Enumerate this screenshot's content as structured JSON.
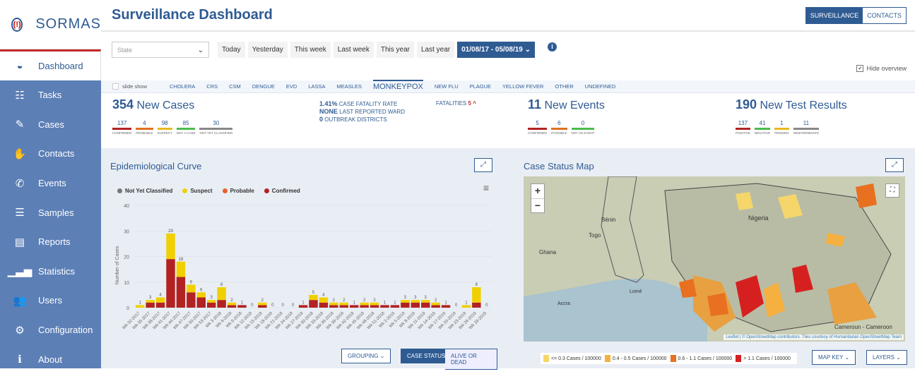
{
  "app": {
    "name": "SORMAS",
    "logo_mark": "(!)"
  },
  "sidebar": {
    "items": [
      {
        "label": "Dashboard",
        "icon": "dashboard-icon",
        "glyph": "◒"
      },
      {
        "label": "Tasks",
        "icon": "tasks-icon",
        "glyph": "☷"
      },
      {
        "label": "Cases",
        "icon": "edit-icon",
        "glyph": "✎"
      },
      {
        "label": "Contacts",
        "icon": "hand-icon",
        "glyph": "✋"
      },
      {
        "label": "Events",
        "icon": "phone-icon",
        "glyph": "✆"
      },
      {
        "label": "Samples",
        "icon": "database-icon",
        "glyph": "☰"
      },
      {
        "label": "Reports",
        "icon": "file-icon",
        "glyph": "▤"
      },
      {
        "label": "Statistics",
        "icon": "bar-chart-icon",
        "glyph": "▁▃▅"
      },
      {
        "label": "Users",
        "icon": "users-icon",
        "glyph": "👥"
      },
      {
        "label": "Configuration",
        "icon": "cogs-icon",
        "glyph": "⚙"
      },
      {
        "label": "About",
        "icon": "info-icon",
        "glyph": "ℹ"
      }
    ]
  },
  "header": {
    "title": "Surveillance Dashboard",
    "switch": [
      "SURVEILLANCE",
      "CONTACTS"
    ]
  },
  "filters": {
    "state_placeholder": "State",
    "periods": [
      "Today",
      "Yesterday",
      "This week",
      "Last week",
      "This year",
      "Last year"
    ],
    "date_range": "01/08/17 - 05/08/19 ⌄",
    "hide_overview": "Hide overview"
  },
  "diseases": {
    "slideshow": "slide show",
    "tabs": [
      "CHOLERA",
      "CRS",
      "CSM",
      "DENGUE",
      "EVD",
      "LASSA",
      "MEASLES",
      "MONKEYPOX",
      "NEW FLU",
      "PLAGUE",
      "YELLOW FEVER",
      "OTHER",
      "UNDEFINED"
    ],
    "active": "MONKEYPOX"
  },
  "cases": {
    "count": "354",
    "label": "New Cases",
    "parts": [
      {
        "v": "137",
        "l": "CONFIRMED",
        "c": "#b22222"
      },
      {
        "v": "4",
        "l": "PROBABLE",
        "c": "#e07020"
      },
      {
        "v": "98",
        "l": "SUSPECT",
        "c": "#e8b820"
      },
      {
        "v": "85",
        "l": "NOT A CASE",
        "c": "#4cbb4c"
      },
      {
        "v": "30",
        "l": "NOT YET CLASSIFIED",
        "c": "#888888"
      }
    ]
  },
  "mid": {
    "cfr": "1.41%",
    "cfr_l": "CASE FATALITY RATE",
    "ward": "NONE",
    "ward_l": "LAST REPORTED WARD",
    "outb": "0",
    "outb_l": "OUTBREAK DISTRICTS",
    "fat_l": "FATALITIES",
    "fat_v": "5"
  },
  "events": {
    "count": "11",
    "label": "New Events",
    "parts": [
      {
        "v": "5",
        "l": "CONFIRMED",
        "c": "#b22222"
      },
      {
        "v": "6",
        "l": "POSSIBLE",
        "c": "#e07020"
      },
      {
        "v": "0",
        "l": "NOT AN EVENT",
        "c": "#4cbb4c"
      }
    ]
  },
  "tests": {
    "count": "190",
    "label": "New Test Results",
    "parts": [
      {
        "v": "137",
        "l": "POSITIVE",
        "c": "#b22222"
      },
      {
        "v": "41",
        "l": "NEGATIVE",
        "c": "#4cbb4c"
      },
      {
        "v": "1",
        "l": "PENDING",
        "c": "#e8b820"
      },
      {
        "v": "11",
        "l": "INDETERMINATE",
        "c": "#888888"
      }
    ]
  },
  "epi": {
    "title": "Epidemiological Curve",
    "grouping": "GROUPING ⌄",
    "case_status": "CASE STATUS",
    "alive": "ALIVE OR DEAD"
  },
  "map": {
    "title": "Case Status Map",
    "attribution": "Leaflet | © OpenStreetMap contributors. Tiles courtesy of Humanitarian OpenStreetMap Team",
    "labels": [
      "Bénin",
      "Nigeria",
      "Togo",
      "Ghana",
      "Accra",
      "Lomé",
      "Cameroun - Cameroon"
    ],
    "legend": [
      {
        "l": "<= 0.3 Cases / 100000",
        "c": "#f5d66a"
      },
      {
        "l": "0.4 - 0.5 Cases / 100000",
        "c": "#f5b040"
      },
      {
        "l": "0.6 - 1.1 Cases / 100000",
        "c": "#e87020"
      },
      {
        "l": "> 1.1 Cases / 100000",
        "c": "#d62020"
      }
    ],
    "map_key": "MAP KEY ⌄",
    "layers": "LAYERS ⌄"
  },
  "colors": {
    "brand": "#2f5b93",
    "sidebar": "#5c7fb6"
  },
  "chart_data": {
    "type": "bar",
    "stacked": true,
    "ylabel": "Number of Cases",
    "ylim": [
      0,
      40
    ],
    "yticks": [
      0,
      10,
      20,
      30,
      40
    ],
    "series": [
      {
        "name": "Not Yet Classified",
        "color": "#777777"
      },
      {
        "name": "Suspect",
        "color": "#f0d000"
      },
      {
        "name": "Probable",
        "color": "#e8602c"
      },
      {
        "name": "Confirmed",
        "color": "#b22222"
      }
    ],
    "categories": [
      "Wk 32-2017",
      "Wk 35-2017",
      "Wk 38-2017",
      "Wk 41-2017",
      "Wk 44-2017",
      "Wk 47-2017",
      "Wk 50-2017",
      "Wk 53-2017",
      "Wk 3-2018",
      "Wk 6-2018",
      "Wk 9-2018",
      "Wk 12-2018",
      "Wk 15-2018",
      "Wk 18-2018",
      "Wk 21-2018",
      "Wk 24-2018",
      "Wk 27-2018",
      "Wk 30-2018",
      "Wk 33-2018",
      "Wk 36-2018",
      "Wk 39-2018",
      "Wk 42-2018",
      "Wk 45-2018",
      "Wk 48-2018",
      "Wk 51-2018",
      "Wk 2-2019",
      "Wk 5-2019",
      "Wk 8-2019",
      "Wk 11-2019",
      "Wk 14-2019",
      "Wk 17-2019",
      "Wk 20-2019",
      "Wk 23-2019",
      "Wk 26-2019",
      "Wk 29-2019"
    ],
    "totals": [
      1,
      3,
      4,
      29,
      18,
      9,
      6,
      3,
      8,
      2,
      1,
      0,
      2,
      0,
      0,
      0,
      1,
      5,
      4,
      2,
      2,
      1,
      2,
      2,
      1,
      1,
      3,
      3,
      3,
      2,
      1,
      0,
      1,
      8,
      0
    ],
    "confirmed": [
      0,
      2,
      2,
      19,
      12,
      6,
      4,
      2,
      3,
      1,
      1,
      0,
      1,
      0,
      0,
      0,
      1,
      3,
      2,
      1,
      1,
      1,
      1,
      1,
      1,
      1,
      2,
      2,
      2,
      1,
      1,
      0,
      0,
      2,
      0
    ]
  }
}
